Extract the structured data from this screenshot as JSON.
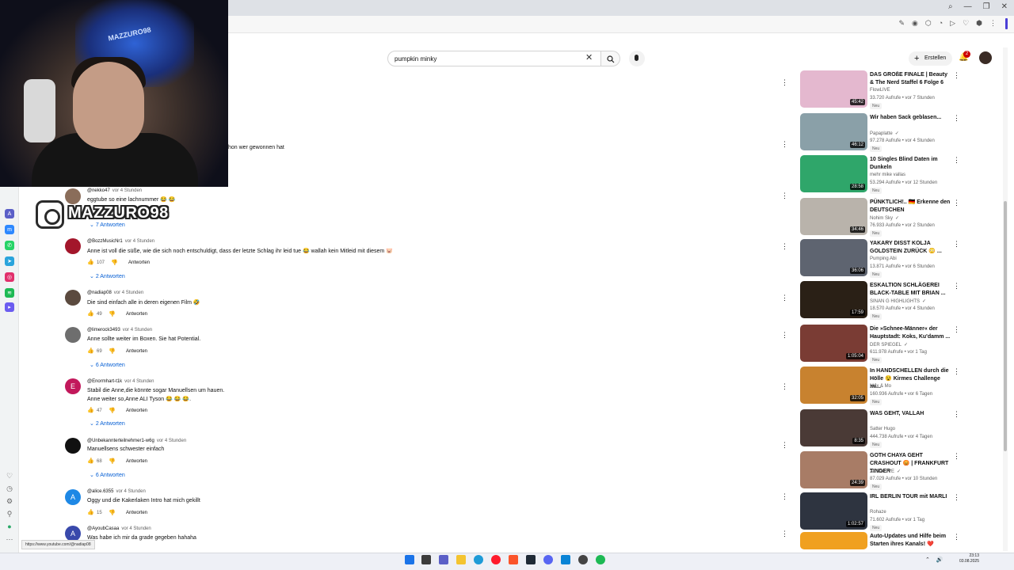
{
  "search": {
    "query": "pumpkin minky"
  },
  "header": {
    "create_label": "Erstellen",
    "notifications": "2"
  },
  "overlay": {
    "instagram_handle": "MAZZURO98",
    "webcam_logo_text": "MAZZURO98"
  },
  "video_snippet": "hon wer gewonnen hat",
  "comments": [
    {
      "author": "@nekko47",
      "time": "vor 4 Stunden",
      "text": "eggtube so eine lachnummer 😂 😂",
      "likes": "",
      "reply_label": "",
      "replies": "7 Antworten",
      "avatar_letter": "",
      "avatar_color": "#8a6d5a"
    },
    {
      "author": "@BozzMusicNr1",
      "time": "vor 4 Stunden",
      "text": "Anne ist voll die süße, wie die sich noch entschuldigt, dass der letzte Schlag ihr leid tue 😂 wallah kein Mitleid mit diesem 🐷",
      "likes": "107",
      "reply_label": "Antworten",
      "replies": "2 Antworten",
      "avatar_letter": "",
      "avatar_color": "#a3162b"
    },
    {
      "author": "@nadiap08",
      "time": "vor 4 Stunden",
      "text": "Die sind einfach alle in deren eigenen Film 🤣",
      "likes": "49",
      "reply_label": "Antworten",
      "replies": "",
      "avatar_letter": "",
      "avatar_color": "#5b4a3f"
    },
    {
      "author": "@limerock3493",
      "time": "vor 4 Stunden",
      "text": "Anne sollte weiter im Boxen. Sie hat Potential.",
      "likes": "69",
      "reply_label": "Antworten",
      "replies": "6 Antworten",
      "avatar_letter": "",
      "avatar_color": "#6e6e6e"
    },
    {
      "author": "@Enormhart-t1k",
      "time": "vor 4 Stunden",
      "text": "Stabil die Anne,die könnte sogar Manuellsen um hauen.",
      "text2": "Anne weiter so,Anne ALI Tyson 😂 😂 😂.",
      "likes": "47",
      "reply_label": "Antworten",
      "replies": "2 Antworten",
      "avatar_letter": "E",
      "avatar_color": "#c2185b"
    },
    {
      "author": "@Unbekannterteilnehmer1-w6g",
      "time": "vor 4 Stunden",
      "text": "Manuellsens schwester einfach",
      "likes": "68",
      "reply_label": "Antworten",
      "replies": "6 Antworten",
      "avatar_letter": "",
      "avatar_color": "#111111"
    },
    {
      "author": "@alice.6355",
      "time": "vor 4 Stunden",
      "text": "Oggy und die Kakerlaken Intro hat mich gekillt",
      "likes": "15",
      "reply_label": "Antworten",
      "replies": "",
      "avatar_letter": "A",
      "avatar_color": "#1e88e5"
    },
    {
      "author": "@AyoubCasaa",
      "time": "vor 4 Stunden",
      "text": "Was habe ich mir da grade gegeben hahaha",
      "likes": "",
      "reply_label": "",
      "replies": "",
      "avatar_letter": "A",
      "avatar_color": "#3949ab"
    }
  ],
  "recommendations": [
    {
      "title": "DAS GROßE FINALE | Beauty & The Nerd Staffel 6 Folge 6",
      "channel": "FlowLIVE",
      "verified": "",
      "meta": "33.720 Aufrufe • vor 7 Stunden",
      "badge": "Neu",
      "duration": "45:42",
      "color": "#e4b8cf"
    },
    {
      "title": "Wir haben Sack geblasen...",
      "channel": "Papaplatte",
      "verified": "✓",
      "meta": "97.278 Aufrufe • vor 4 Stunden",
      "badge": "Neu",
      "duration": "46:12",
      "color": "#8aa0a8"
    },
    {
      "title": "10 Singles Blind Daten im Dunkeln",
      "channel": "mehr mike vallas",
      "verified": "",
      "meta": "53.294 Aufrufe • vor 12 Stunden",
      "badge": "Neu",
      "duration": "28:58",
      "color": "#2fa66a"
    },
    {
      "title": "PÜNKTLICH!.. 🇩🇪 Erkenne den DEUTSCHEN",
      "channel": "Nohim Sky",
      "verified": "✓",
      "meta": "76.933 Aufrufe • vor 2 Stunden",
      "badge": "Neu",
      "duration": "34:46",
      "color": "#b9b3ab"
    },
    {
      "title": "YAKARY DISST KOLJA GOLDSTEIN ZURÜCK 😳 ...",
      "channel": "Pumping Abi",
      "verified": "",
      "meta": "13.871 Aufrufe • vor 6 Stunden",
      "badge": "Neu",
      "duration": "36:06",
      "color": "#5e6470"
    },
    {
      "title": "ESKALTION SCHLÄGEREI BLACK-TABLE MIT BRIAN ...",
      "channel": "SINAN G HIGHLIGHTS",
      "verified": "✓",
      "meta": "18.570 Aufrufe • vor 4 Stunden",
      "badge": "Neu",
      "duration": "17:59",
      "color": "#2a2016"
    },
    {
      "title": "Die »Schnee-Männer« der Hauptstadt: Koks, Ku'damm ...",
      "channel": "DER SPIEGEL",
      "verified": "✓",
      "meta": "611.978 Aufrufe • vor 1 Tag",
      "badge": "Neu",
      "duration": "1:05:04",
      "color": "#7a3c34"
    },
    {
      "title": "In HANDSCHELLEN durch die Hölle 😵 Kirmes Challenge mi...",
      "channel": "Max & Mo",
      "verified": "",
      "meta": "160.936 Aufrufe • vor 6 Tagen",
      "badge": "Neu",
      "duration": "32:05",
      "color": "#c8822f"
    },
    {
      "title": "WAS GEHT, VALLAH",
      "channel": "Satter Hugo",
      "verified": "",
      "meta": "444.738 Aufrufe • vor 4 Tagen",
      "badge": "Neu",
      "duration": "8:35",
      "color": "#4a3a36"
    },
    {
      "title": "GOTH CHAYA GEHT CRASHOUT 😡 | FRANKFURT TINDER",
      "channel": "zarbexLIVE",
      "verified": "✓",
      "meta": "87.029 Aufrufe • vor 10 Stunden",
      "badge": "Neu",
      "duration": "24:39",
      "color": "#a87c66"
    },
    {
      "title": "IRL BERLIN TOUR mit MARLI",
      "channel": "Rohaze",
      "verified": "",
      "meta": "71.602 Aufrufe • vor 1 Tag",
      "badge": "Neu",
      "duration": "1:02:57",
      "color": "#2e3440"
    },
    {
      "title": "Auto-Updates und Hilfe beim Starten ihres Kanals! ❤️",
      "channel": "",
      "verified": "",
      "meta": "",
      "badge": "",
      "duration": "",
      "color": "#f0a020"
    }
  ],
  "status_url": "https://www.youtube.com/@nadiap08",
  "clock": {
    "time": "23:13",
    "date": "03.08.2025"
  }
}
